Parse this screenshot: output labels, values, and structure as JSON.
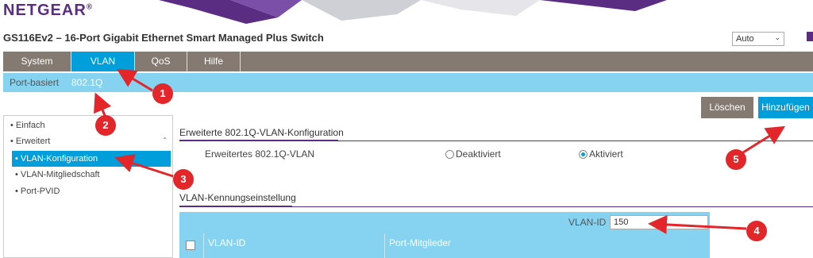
{
  "brand": {
    "logo": "NETGEAR",
    "registered": "®"
  },
  "device": {
    "title": "GS116Ev2 – 16-Port Gigabit Ethernet Smart Managed Plus Switch"
  },
  "language": {
    "selected": "Auto"
  },
  "tabs": [
    {
      "label": "System"
    },
    {
      "label": "VLAN",
      "active": true
    },
    {
      "label": "QoS"
    },
    {
      "label": "Hilfe"
    }
  ],
  "subtabs": [
    {
      "label": "Port-basiert"
    },
    {
      "label": "802.1Q",
      "active": true
    }
  ],
  "sidebar": {
    "items": [
      {
        "label": "• Einfach"
      },
      {
        "label": "• Erweitert"
      },
      {
        "label": "• VLAN-Konfiguration",
        "active": true
      },
      {
        "label": "• VLAN-Mitgliedschaft"
      },
      {
        "label": "• Port-PVID"
      }
    ]
  },
  "buttons": {
    "delete": "Löschen",
    "add": "Hinzufügen"
  },
  "advanced": {
    "section_title": "Erweiterte 802.1Q-VLAN-Konfiguration",
    "field_label": "Erweitertes 802.1Q-VLAN",
    "option_off": "Deaktiviert",
    "option_on": "Aktiviert",
    "selected": "Aktiviert"
  },
  "vlan_id_section": {
    "title": "VLAN-Kennungseinstellung",
    "input_label": "VLAN-ID",
    "input_value": "150",
    "columns": [
      "VLAN-ID",
      "Port-Mitglieder"
    ]
  },
  "annotations": {
    "markers": [
      "1",
      "2",
      "3",
      "4",
      "5"
    ]
  },
  "colors": {
    "brand_purple": "#5a2d82",
    "accent_blue": "#009fdb",
    "light_blue": "#85d3f1",
    "tab_gray": "#847a72",
    "marker_red": "#e3262a"
  }
}
